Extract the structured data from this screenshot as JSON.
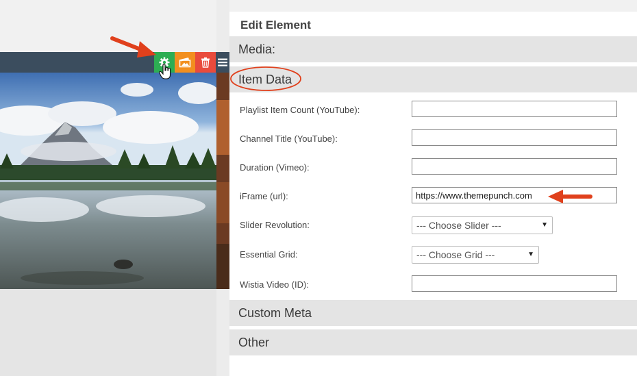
{
  "panel": {
    "title": "Edit Element",
    "sections": {
      "media": "Media:",
      "item_data": "Item Data",
      "custom_meta": "Custom Meta",
      "other": "Other"
    },
    "fields": [
      {
        "label": "Playlist Item Count (YouTube):",
        "value": ""
      },
      {
        "label": "Channel Title (YouTube):",
        "value": ""
      },
      {
        "label": "Duration (Vimeo):",
        "value": ""
      },
      {
        "label": "iFrame (url):",
        "value": "https://www.themepunch.com"
      },
      {
        "label": "Slider Revolution:",
        "selected": "--- Choose Slider ---"
      },
      {
        "label": "Essential Grid:",
        "selected": "--- Choose Grid ---"
      },
      {
        "label": "Wistia Video (ID):",
        "value": ""
      }
    ]
  },
  "toolbar": {
    "icons": [
      "gear-icon",
      "media-icon",
      "trash-icon",
      "hamburger-icon"
    ],
    "colors": {
      "settings": "#2dad53",
      "media": "#f28f1f",
      "delete": "#e94b3c",
      "bar": "#3b4d5e"
    }
  },
  "annotation_color": "#e0401c"
}
